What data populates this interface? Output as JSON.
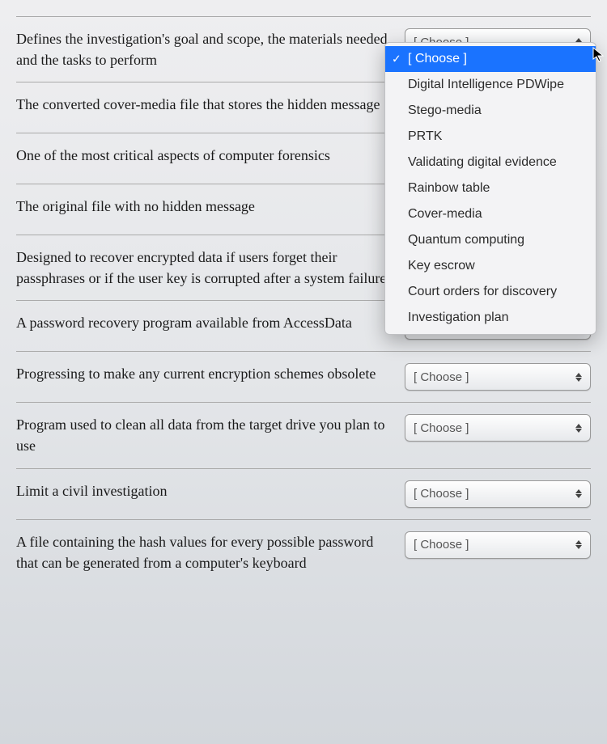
{
  "placeholder": "[ Choose ]",
  "prompts": [
    "Defines the investigation's goal and scope, the materials needed, and the tasks to perform",
    "The converted cover-media file that stores the hidden message",
    "One of the most critical aspects of computer forensics",
    "The original file with no hidden message",
    "Designed to recover encrypted data if users forget their passphrases or if the user key is corrupted after a system failure",
    "A password recovery program available from AccessData",
    "Progressing to make any current encryption schemes obsolete",
    "Program used to clean all data from the target drive you plan to use",
    "Limit a civil investigation",
    "A file containing the hash values for every possible password that can be generated from a computer's keyboard"
  ],
  "dropdown": {
    "selected_index": 0,
    "options": [
      "[ Choose ]",
      "Digital Intelligence PDWipe",
      "Stego-media",
      "PRTK",
      "Validating digital evidence",
      "Rainbow table",
      "Cover-media",
      "Quantum computing",
      "Key escrow",
      "Court orders for discovery",
      "Investigation plan"
    ]
  }
}
